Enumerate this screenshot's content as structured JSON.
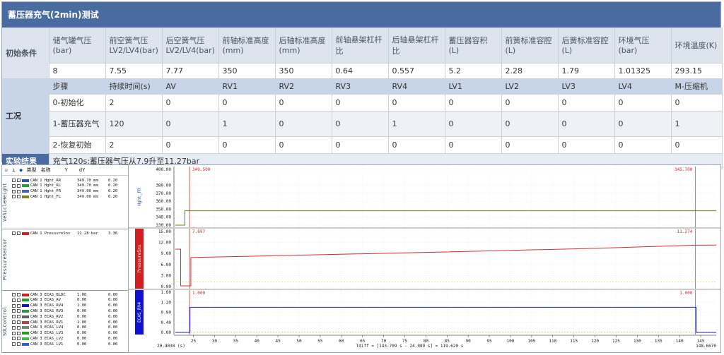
{
  "title": "蓄压器充气(2min)测试",
  "sections": {
    "init": "初始条件",
    "work": "工况",
    "result": "实验结果"
  },
  "init_headers": [
    "储气罐气压(bar)",
    "前空簧气压LV2/LV4(bar)",
    "后空簧气压LV2/LV4(bar)",
    "前轴标准高度(mm)",
    "后轴标准高度(mm)",
    "前轴悬架杠杆比",
    "后轴悬架杠杆比",
    "蓄压器容积(L)",
    "前簧标准容腔(L)",
    "后簧标准容腔(L)",
    "环境气压(bar)",
    "环境温度(K)"
  ],
  "init_values": [
    "8",
    "7.55",
    "7.77",
    "350",
    "350",
    "0.64",
    "0.557",
    "5.2",
    "2.28",
    "1.79",
    "1.01325",
    "293.15"
  ],
  "op_headers": [
    "步骤",
    "持续时间(s)",
    "AV",
    "RV1",
    "RV2",
    "RV3",
    "RV4",
    "LV1",
    "LV2",
    "LV3",
    "LV4",
    "M-压缩机"
  ],
  "op_rows": [
    [
      "0-初始化",
      "2",
      "0",
      "0",
      "0",
      "0",
      "0",
      "0",
      "0",
      "0",
      "0",
      "0"
    ],
    [
      "1-蓄压器充气",
      "120",
      "0",
      "1",
      "0",
      "0",
      "1",
      "0",
      "0",
      "0",
      "0",
      "1"
    ],
    [
      "2-恢复初始",
      "2",
      "0",
      "0",
      "0",
      "0",
      "0",
      "0",
      "0",
      "0",
      "0",
      "0"
    ]
  ],
  "result_text": "充气120s:蓄压器气压从7.9升至11.27bar",
  "trace": {
    "toolbar": [
      "类型",
      "名称",
      "Y",
      "dY"
    ],
    "groups": [
      {
        "label": "VehicleHeight",
        "signals": [
          {
            "name": "CAN 1  Hght_RR",
            "val": "349.70 mm",
            "d": "0.20",
            "color": "#3050c0"
          },
          {
            "name": "CAN 1  Hght_RL",
            "val": "349.70 mm",
            "d": "0.20",
            "color": "#20a040"
          },
          {
            "name": "CAN 1  Hght_FR",
            "val": "349.00 mm",
            "d": "0.20",
            "color": "#4060d0"
          },
          {
            "name": "CAN 1  Hght_FL",
            "val": "349.00 mm",
            "d": "0.20",
            "color": "#808020"
          }
        ]
      },
      {
        "label": "PressureSensor",
        "signals": [
          {
            "name": "CAN 1  PressureSns",
            "val": "11.28 bar",
            "d": "3.36",
            "color": "#d02020"
          }
        ]
      },
      {
        "label": "SOLControl",
        "signals": [
          {
            "name": "CAN 3  ECAS_BLDC",
            "val": "1.00",
            "d": "0.00",
            "color": "#d02020"
          },
          {
            "name": "CAN 3  ECAS_AV",
            "val": "0.00",
            "d": "0.00",
            "color": "#20a020"
          },
          {
            "name": "CAN 3  ECAS_RV4",
            "val": "1.00",
            "d": "0.00",
            "color": "#1010d0"
          },
          {
            "name": "CAN 3  ECAS_RV3",
            "val": "0.00",
            "d": "0.00",
            "color": "#20a040"
          },
          {
            "name": "CAN 3  ECAS_RV2",
            "val": "0.00",
            "d": "0.00",
            "color": "#606060"
          },
          {
            "name": "CAN 3  ECAS_RV1",
            "val": "1.00",
            "d": "0.00",
            "color": "#c04040"
          },
          {
            "name": "CAN 3  ECAS_LV4",
            "val": "0.00",
            "d": "0.00",
            "color": "#808080"
          },
          {
            "name": "CAN 3  ECAS_LV3",
            "val": "0.00",
            "d": "0.00",
            "color": "#20a020"
          },
          {
            "name": "CAN 3  ECAS_LV2",
            "val": "0.00",
            "d": "0.00",
            "color": "#40c040"
          },
          {
            "name": "CAN 3  ECAS_LV1",
            "val": "0.00",
            "d": "0.00",
            "color": "#3060c0"
          }
        ]
      }
    ],
    "axis_names": [
      "Hght_FR",
      "PressureSns",
      "ECAS_RV4"
    ],
    "x_axis": {
      "ticks": [
        25,
        30,
        35,
        40,
        45,
        50,
        55,
        60,
        65,
        70,
        75,
        80,
        85,
        90,
        95,
        100,
        105,
        110,
        115,
        120,
        125,
        130,
        135,
        140,
        145
      ],
      "start_label": "20.4038 (s)",
      "end_label": "148.6670",
      "delta_label": "Tdiff = [143.709 s - 24.089 s] = 119.620 s",
      "range": [
        20.4038,
        148.667
      ]
    },
    "cursors": {
      "left_time": 24.089,
      "right_time": 143.709
    },
    "panels": [
      {
        "id": "height",
        "ylim": [
          330,
          400
        ],
        "ticks": [
          "400.00",
          "380.00",
          "370.00",
          "360.00",
          "350.00",
          "340.00",
          "330.00"
        ],
        "tick_vals": [
          400,
          380,
          370,
          360,
          350,
          340,
          330
        ],
        "cursor_left_label": "349.500",
        "cursor_right_label": "345.700",
        "accent": "#3050c0"
      },
      {
        "id": "pressure",
        "ylim": [
          0,
          15
        ],
        "ticks": [
          "15.00",
          "12.00",
          "9.00",
          "6.00",
          "3.00",
          "0.00"
        ],
        "tick_vals": [
          15,
          12,
          9,
          6,
          3,
          0
        ],
        "cursor_left_label": "7.897",
        "cursor_right_label": "11.274",
        "accent": "#d02020"
      },
      {
        "id": "rv4",
        "ylim": [
          0,
          1.6
        ],
        "ticks": [
          "1.60",
          "1.20",
          "0.80",
          "0.40",
          "0.00"
        ],
        "tick_vals": [
          1.6,
          1.2,
          0.8,
          0.4,
          0.0
        ],
        "cursor_left_label": "1.000",
        "cursor_right_label": "1.000",
        "accent": "#1010d0"
      }
    ]
  }
}
